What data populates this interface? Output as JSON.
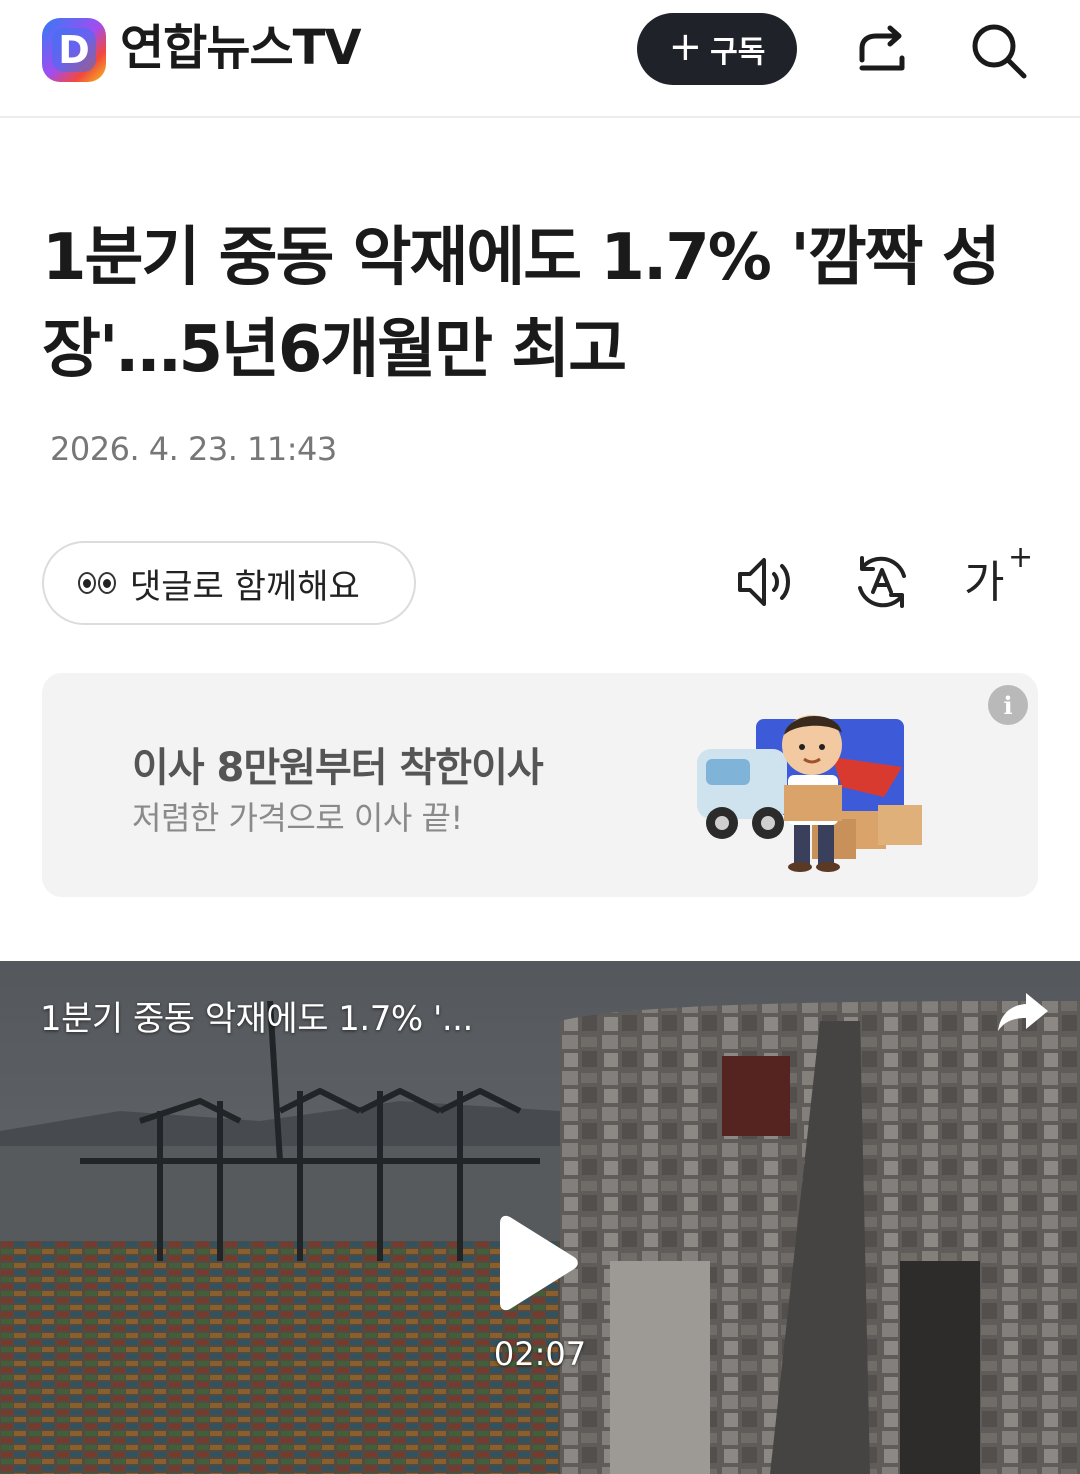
{
  "header": {
    "brand": "연합뉴스TV",
    "logo_letter": "D",
    "subscribe_plus": "+",
    "subscribe_label": "구독"
  },
  "article": {
    "headline": "1분기 중동 악재에도 1.7% '깜짝 성장'…5년6개월만 최고",
    "date": "2026. 4. 23. 11:43"
  },
  "tools": {
    "comment_label": "댓글로 함께해요",
    "font_size_label": "가",
    "font_size_plus": "+"
  },
  "ad": {
    "title": "이사 8만원부터 착한이사",
    "subtitle": "저렴한 가격으로 이사 끝!",
    "info_label": "i"
  },
  "video": {
    "title": "1분기 중동 악재에도 1.7% '...",
    "duration": "02:07"
  },
  "colors": {
    "subscribe_bg": "#1f2329",
    "ad_bg": "#f3f3f4",
    "date_text": "#777777"
  }
}
